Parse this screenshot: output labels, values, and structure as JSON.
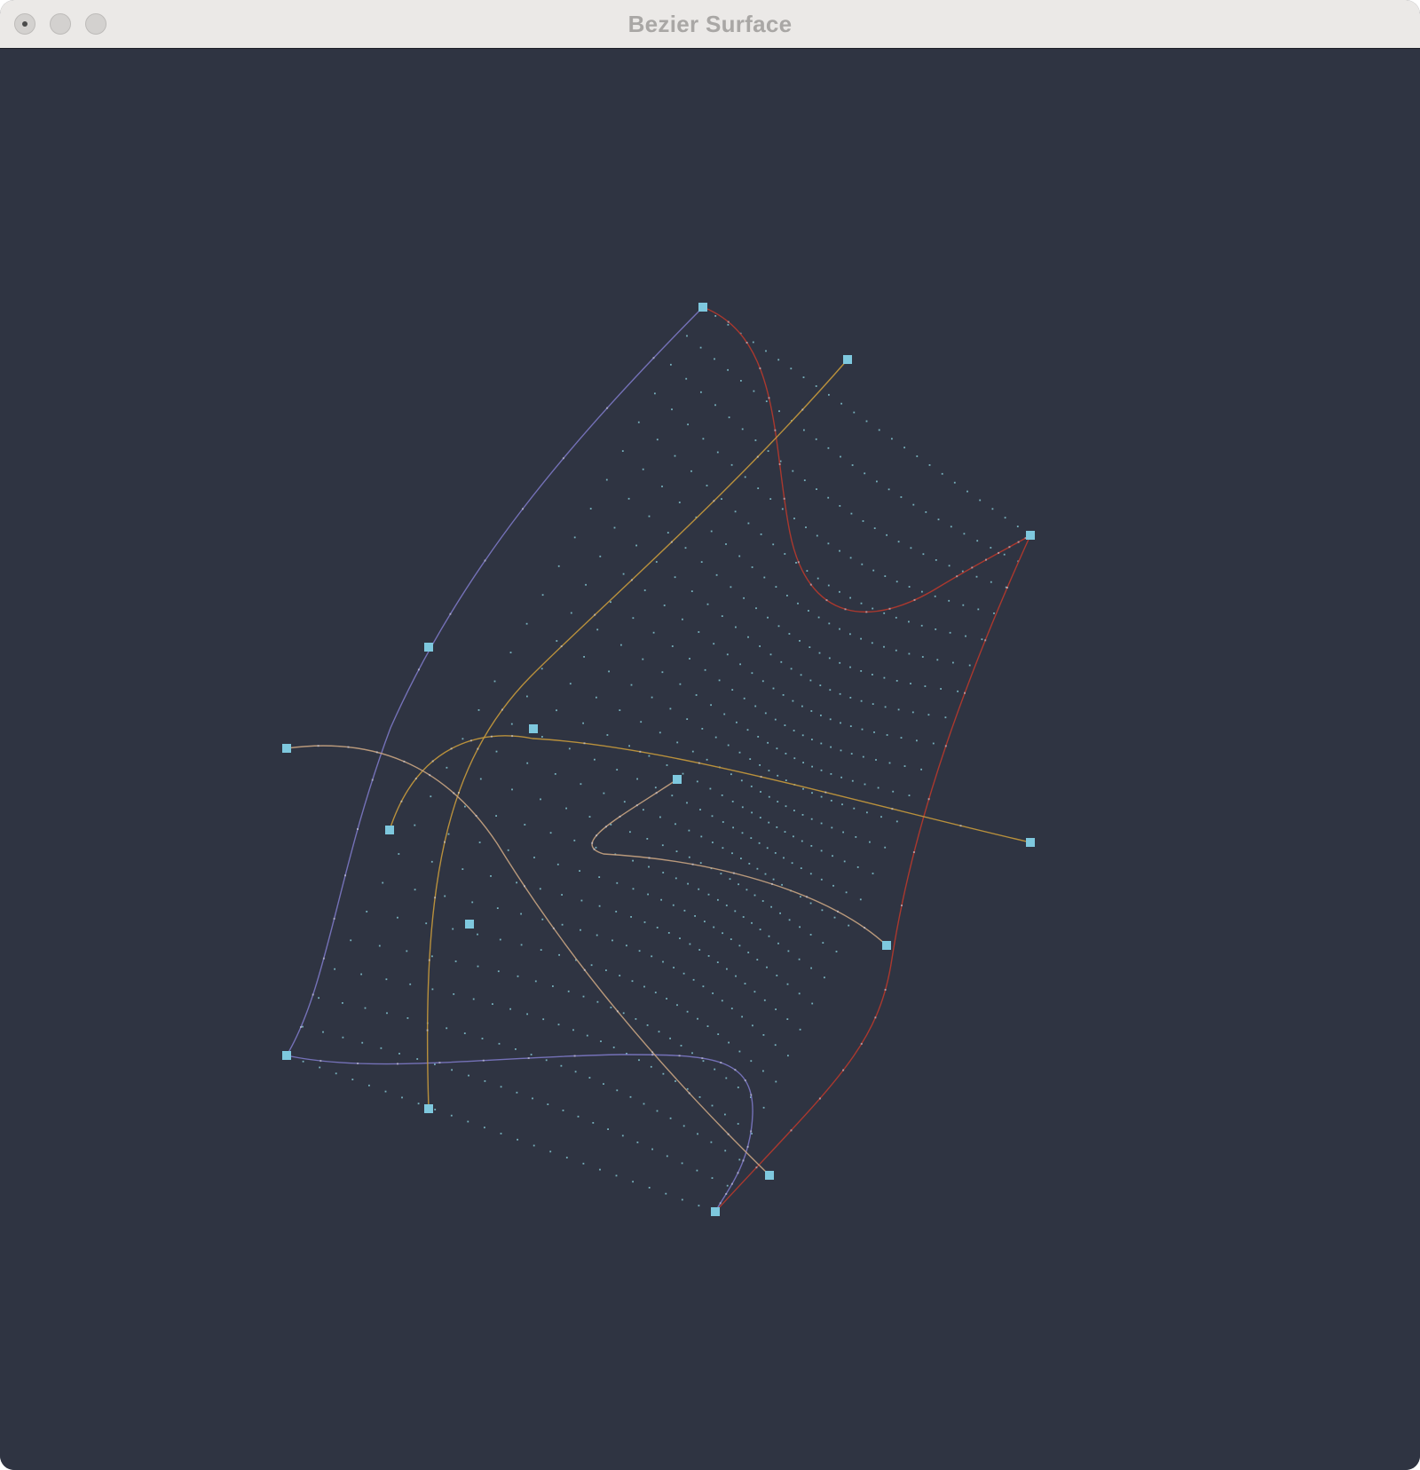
{
  "window": {
    "title": "Bezier Surface"
  },
  "titlebar": {
    "buttons": [
      {
        "name": "close",
        "icon": "close-dot-icon"
      },
      {
        "name": "minimize",
        "icon": "minimize-icon"
      },
      {
        "name": "zoom",
        "icon": "zoom-icon"
      }
    ]
  },
  "colors": {
    "background": "#2f3442",
    "boundary_u0": "#7c78c4",
    "boundary_v0": "#7c78c4",
    "boundary_u1": "#b8382c",
    "boundary_v1": "#b8382c",
    "iso_curve_1": "#c89a3c",
    "iso_curve_2": "#c89a3c",
    "iso_curve_3": "#c9a482",
    "iso_curve_4": "#c9a482",
    "control_point": "#7ec8de",
    "sample_point": "#8fd9e6"
  }
}
